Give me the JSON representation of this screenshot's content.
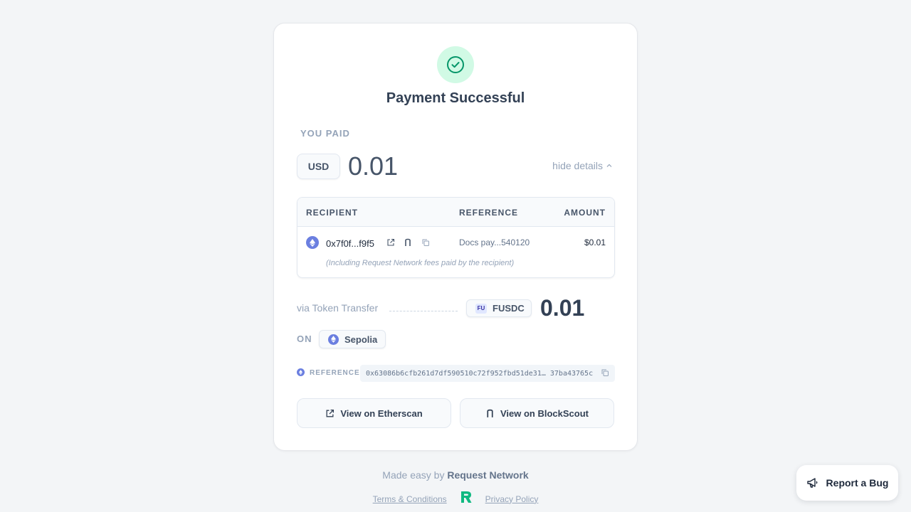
{
  "receipt": {
    "title": "Payment Successful",
    "you_paid_label": "YOU PAID",
    "currency": "USD",
    "amount": "0.01",
    "hide_details": "hide details"
  },
  "table": {
    "headers": {
      "recipient": "RECIPIENT",
      "reference": "REFERENCE",
      "amount": "AMOUNT"
    },
    "row": {
      "recipient": "0x7f0f...f9f5",
      "reference": "Docs pay...540120",
      "amount": "$0.01",
      "note": "(Including Request Network fees paid by the recipient)"
    }
  },
  "transfer": {
    "via_label": "via Token Transfer",
    "token_badge": "FU",
    "token": "FUSDC",
    "token_amount": "0.01",
    "on_label": "ON",
    "network": "Sepolia"
  },
  "reference": {
    "label": "REFERENCE",
    "value": "0x63086b6cfb261d7df590510c72f952fbd51de31… 37ba43765c"
  },
  "buttons": {
    "etherscan": "View on Etherscan",
    "blockscout": "View on BlockScout"
  },
  "footer": {
    "made_easy": "Made easy by",
    "brand": "Request Network",
    "terms": "Terms & Conditions",
    "privacy": "Privacy Policy"
  },
  "report_bug": "Report a Bug",
  "colors": {
    "success_bg": "#d1fae5",
    "success_icon": "#059669",
    "eth_accent": "#6b7fe0",
    "brand_logo": "#10b981"
  }
}
